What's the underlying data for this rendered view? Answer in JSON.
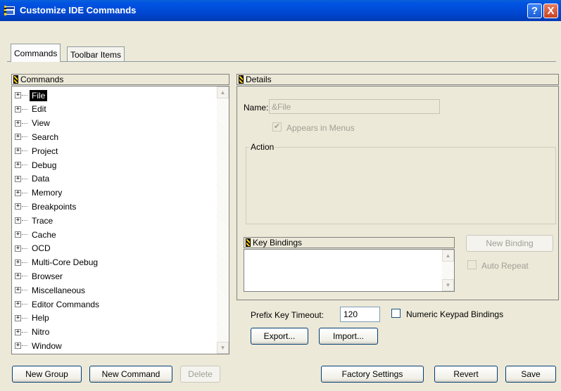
{
  "window": {
    "title": "Customize IDE Commands",
    "help_label": "?",
    "close_label": "X"
  },
  "tabs": [
    {
      "label": "Commands",
      "active": true
    },
    {
      "label": "Toolbar Items",
      "active": false
    }
  ],
  "commands_panel": {
    "header": "Commands",
    "items": [
      {
        "label": "File",
        "selected": true
      },
      {
        "label": "Edit"
      },
      {
        "label": "View"
      },
      {
        "label": "Search"
      },
      {
        "label": "Project"
      },
      {
        "label": "Debug"
      },
      {
        "label": "Data"
      },
      {
        "label": "Memory"
      },
      {
        "label": "Breakpoints"
      },
      {
        "label": "Trace"
      },
      {
        "label": "Cache"
      },
      {
        "label": "OCD"
      },
      {
        "label": "Multi-Core Debug"
      },
      {
        "label": "Browser"
      },
      {
        "label": "Miscellaneous"
      },
      {
        "label": "Editor Commands"
      },
      {
        "label": "Help"
      },
      {
        "label": "Nitro"
      },
      {
        "label": "Window"
      }
    ],
    "expander_symbol": "+"
  },
  "details": {
    "header": "Details",
    "name_label": "Name:",
    "name_value": "&File",
    "appears_in_menus_label": "Appears in Menus",
    "appears_in_menus_checked": true,
    "action_label": "Action",
    "key_bindings_header": "Key Bindings",
    "new_binding_label": "New Binding",
    "auto_repeat_label": "Auto Repeat"
  },
  "options": {
    "prefix_key_timeout_label": "Prefix Key Timeout:",
    "prefix_key_timeout_value": "120",
    "numeric_keypad_label": "Numeric Keypad Bindings",
    "export_label": "Export...",
    "import_label": "Import..."
  },
  "footer": {
    "new_group_label": "New Group",
    "new_command_label": "New Command",
    "delete_label": "Delete",
    "factory_settings_label": "Factory Settings",
    "revert_label": "Revert",
    "save_label": "Save"
  },
  "colors": {
    "titlebar": "#0054e3",
    "window_bg": "#ece9d8",
    "disabled_text": "#a09f94"
  }
}
